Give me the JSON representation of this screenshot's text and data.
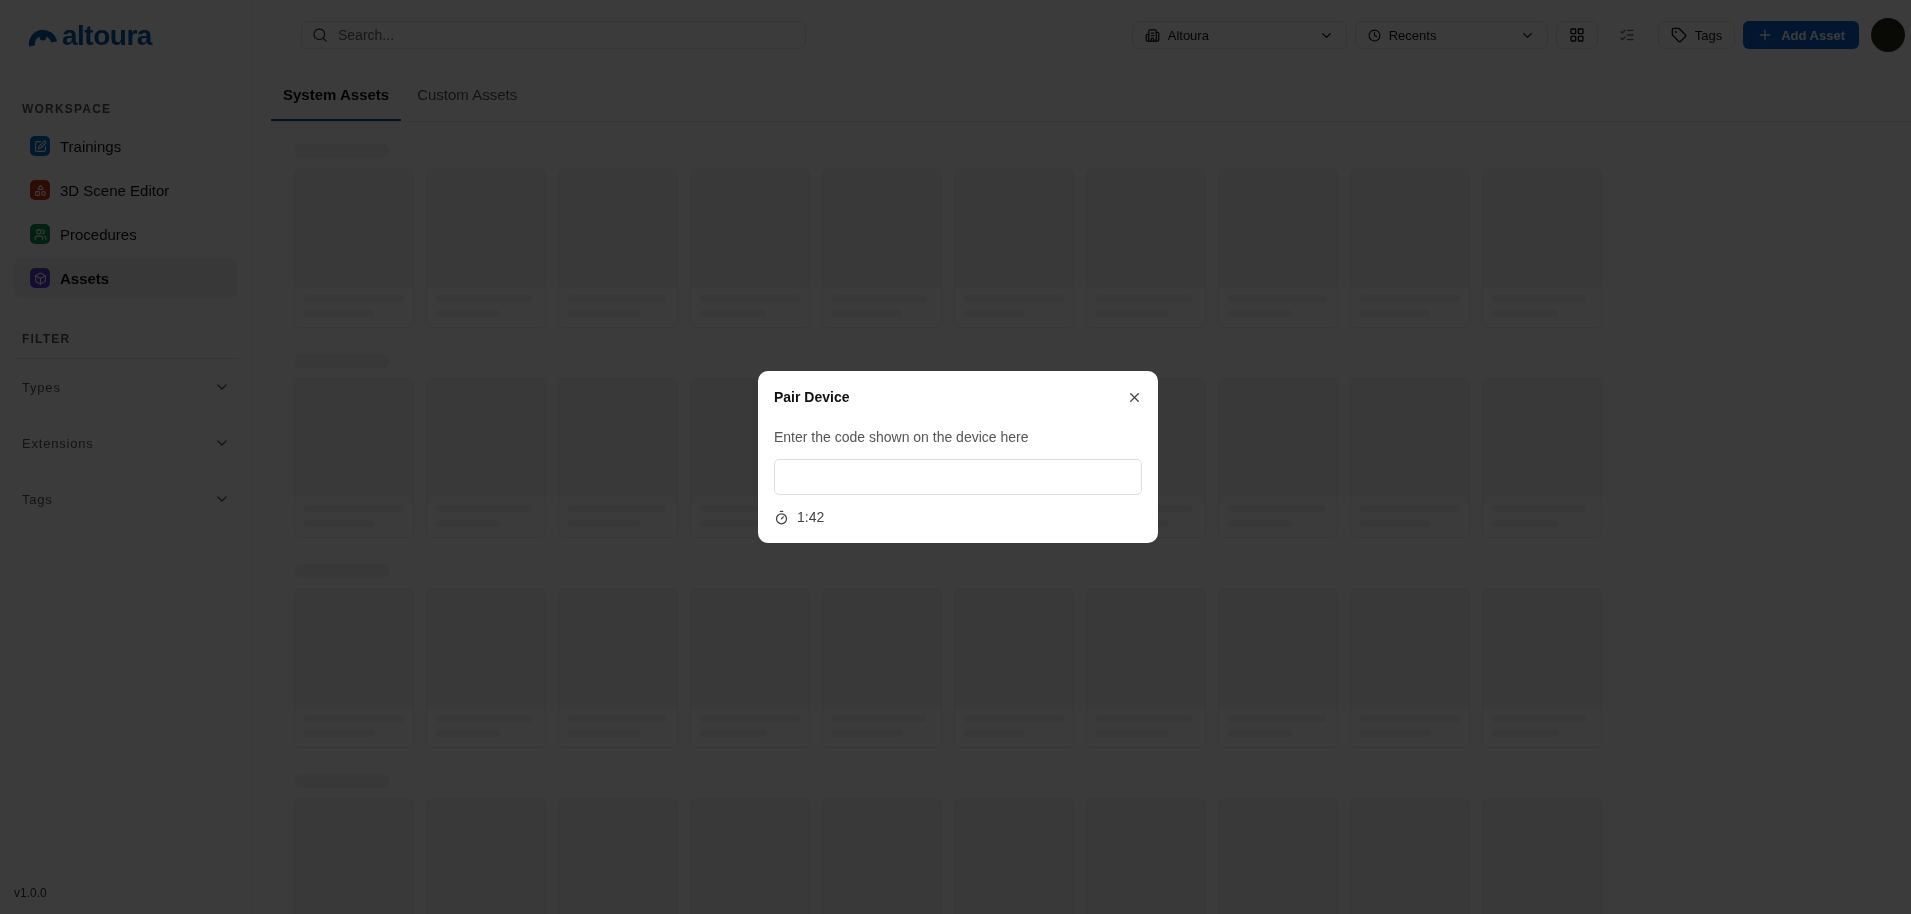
{
  "sidebar": {
    "logo": "altoura",
    "workspace_label": "WORKSPACE",
    "items": [
      {
        "label": "Trainings",
        "selected": false
      },
      {
        "label": "3D Scene Editor",
        "selected": false
      },
      {
        "label": "Procedures",
        "selected": false
      },
      {
        "label": "Assets",
        "selected": true
      }
    ],
    "filter_label": "FILTER",
    "filters": [
      {
        "label": "Types",
        "expanded": false
      },
      {
        "label": "Extensions",
        "expanded": false
      },
      {
        "label": "Tags",
        "expanded": false
      }
    ],
    "version": "v1.0.0"
  },
  "topbar": {
    "search": {
      "placeholder": "Search..."
    },
    "organization": "Altoura",
    "sort": "Recents",
    "view_buttons": [
      {
        "selected": true
      },
      {
        "selected": false
      }
    ],
    "tags_button": "Tags",
    "add_button": "Add Asset"
  },
  "tabs": [
    {
      "label": "System Assets",
      "selected": true
    },
    {
      "label": "Custom Assets",
      "selected": false
    }
  ],
  "dialog": {
    "title": "Pair Device",
    "prompt": "Enter the code shown on the device here",
    "timer": "1:42"
  }
}
